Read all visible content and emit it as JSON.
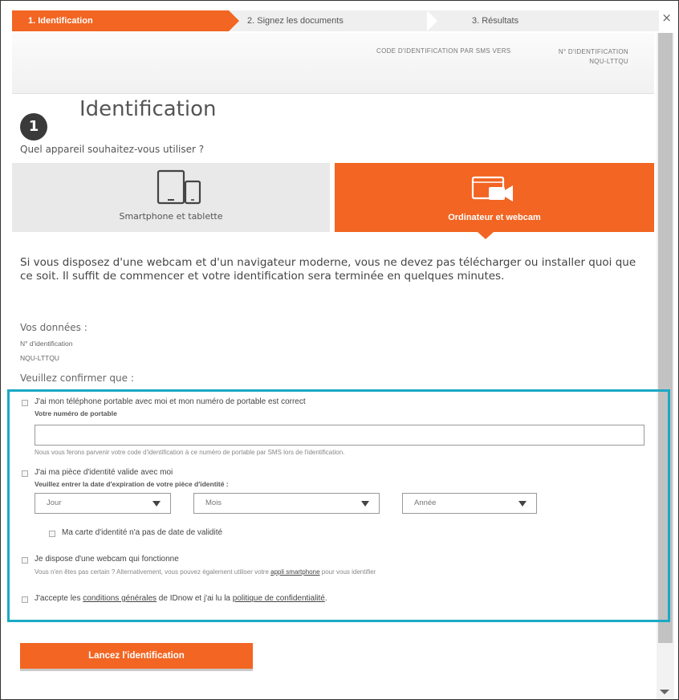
{
  "stepper": {
    "steps": [
      "1. Identification",
      "2. Signez les documents",
      "3. Résultats"
    ],
    "close": "×"
  },
  "header": {
    "sms_code_label": "CODE D'IDENTIFICATION PAR SMS VERS",
    "id_label": "N° D'IDENTIFICATION",
    "id_value": "NQU-LTTQU"
  },
  "title": {
    "number": "1",
    "text": "Identification"
  },
  "device": {
    "question": "Quel appareil souhaitez-vous utiliser ?",
    "options": [
      {
        "label": "Smartphone et tablette",
        "icon": "smartphone-tablet-icon",
        "selected": false
      },
      {
        "label": "Ordinateur et webcam",
        "icon": "webcam-icon",
        "selected": true
      }
    ]
  },
  "description": "Si vous disposez d'une webcam et d'un navigateur moderne, vous ne devez pas télécharger ou installer quoi que ce soit. Il suffit de commencer et votre identification sera terminée en quelques minutes.",
  "data": {
    "heading": "Vos données :",
    "id_label": "N° d'identification",
    "id_value": "NQU-LTTQU"
  },
  "confirm": {
    "heading": "Veuillez confirmer que :",
    "phone_check": "J'ai mon téléphone portable avec moi et mon numéro de portable est correct",
    "phone_label": "Votre numéro de portable",
    "phone_value": "",
    "phone_help": "Nous vous ferons parvenir votre code d'identification à ce numéro de portable par SMS lors de l'identification.",
    "id_check": "J'ai ma pièce d'identité valide avec moi",
    "expiry_label": "Veuillez entrer la date d'expiration de votre pièce d'identité :",
    "day": "Jour",
    "month": "Mois",
    "year": "Année",
    "no_validity": "Ma carte d'identité n'a pas de date de validité",
    "webcam_check": "Je dispose d'une webcam qui fonctionne",
    "webcam_help_pre": "Vous n'en êtes pas certain ? Alternativement, vous pouvez également utiliser votre",
    "webcam_help_link": "appli smartphone",
    "webcam_help_post": "pour vous identifier",
    "terms_pre": "J'accepte les",
    "terms_link": "conditions générales",
    "terms_mid": "de IDnow et j'ai lu la",
    "privacy_link": "politique de confidentialité",
    "terms_post": "."
  },
  "launch_button": "Lancez l'identification",
  "colors": {
    "accent": "#f26522",
    "highlight": "#1aa9c4",
    "dark": "#3a3a3a"
  }
}
